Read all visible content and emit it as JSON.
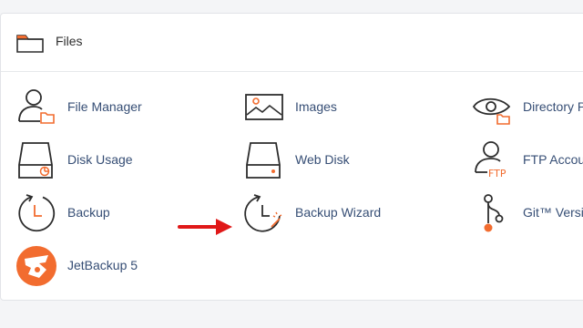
{
  "section": {
    "title": "Files",
    "icon": "folder-icon"
  },
  "tools": [
    {
      "label": "File Manager",
      "icon": "file-manager-icon"
    },
    {
      "label": "Images",
      "icon": "images-icon"
    },
    {
      "label": "Directory P",
      "icon": "directory-privacy-icon"
    },
    {
      "label": "Disk Usage",
      "icon": "disk-usage-icon"
    },
    {
      "label": "Web Disk",
      "icon": "web-disk-icon"
    },
    {
      "label": "FTP Accou",
      "icon": "ftp-accounts-icon"
    },
    {
      "label": "Backup",
      "icon": "backup-icon"
    },
    {
      "label": "Backup Wizard",
      "icon": "backup-wizard-icon"
    },
    {
      "label": "Git™ Versi",
      "icon": "git-icon"
    },
    {
      "label": "JetBackup 5",
      "icon": "jetbackup-icon"
    }
  ],
  "colors": {
    "accent": "#f26c2f",
    "label": "#364e75",
    "arrow": "#e01818",
    "icon_stroke": "#2d2d2d"
  }
}
